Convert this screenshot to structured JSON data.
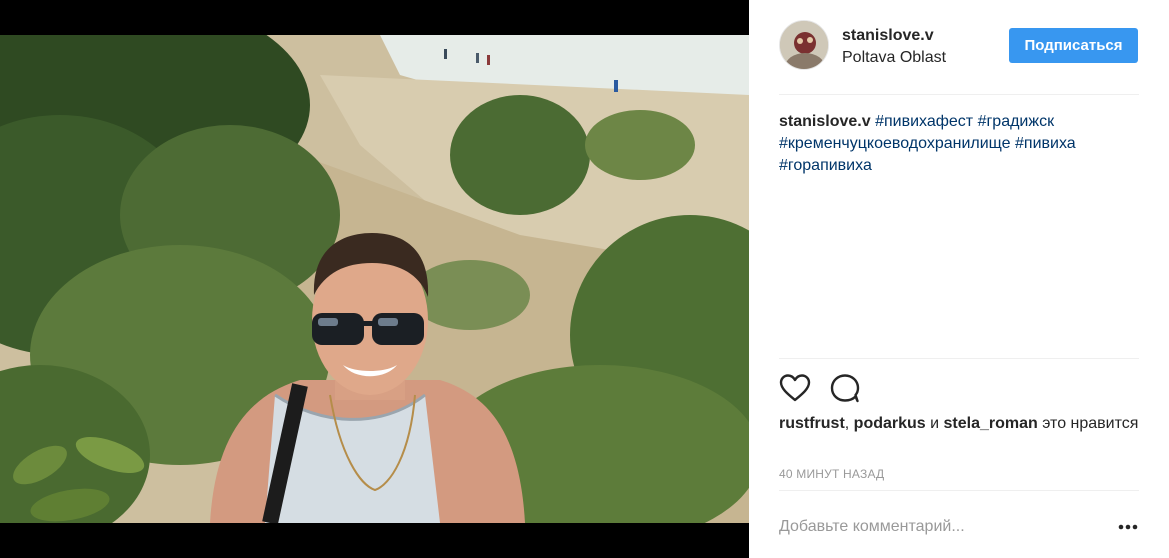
{
  "post": {
    "author": {
      "username": "stanislove.v",
      "location": "Poltava Oblast",
      "avatar_icon": "avatar-photo"
    },
    "follow_label": "Подписаться",
    "caption": {
      "username": "stanislove.v",
      "hashtags": [
        "#пивихафест",
        "#градижск",
        "#кременчуцкоеводохранилище",
        "#пивиха",
        "#горапивиха"
      ]
    },
    "actions": {
      "like_icon": "heart-icon",
      "comment_icon": "comment-icon"
    },
    "likes": {
      "user1": "rustfrust",
      "sep1": ", ",
      "user2": "podarkus",
      "and_word": " и ",
      "user3": "stela_roman",
      "suffix": " это нравится"
    },
    "timestamp": "40 МИНУТ НАЗАД",
    "comment": {
      "placeholder": "Добавьте комментарий...",
      "more_icon": "more-options-icon"
    }
  },
  "colors": {
    "accent": "#3897f0",
    "hashtag": "#003569",
    "muted": "#999999",
    "divider": "#efefef"
  }
}
